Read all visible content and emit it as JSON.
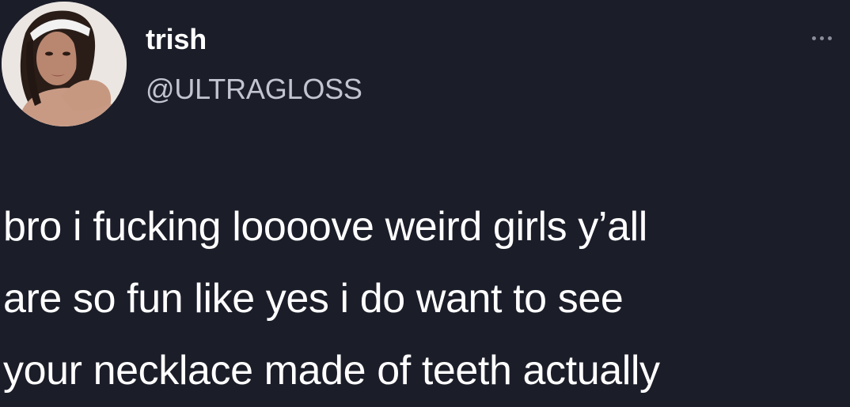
{
  "user": {
    "display_name": "trish",
    "handle": "@ULTRAGLOSS"
  },
  "tweet": {
    "lines": [
      "bro i fucking loooove weird girls y’all",
      "are so fun like yes i do want to see",
      "your necklace made of teeth actually"
    ]
  },
  "icons": {
    "more": "more-horizontal-icon"
  },
  "colors": {
    "background": "#1b1d29",
    "text": "#ffffff",
    "handle": "#c2c5cf"
  }
}
